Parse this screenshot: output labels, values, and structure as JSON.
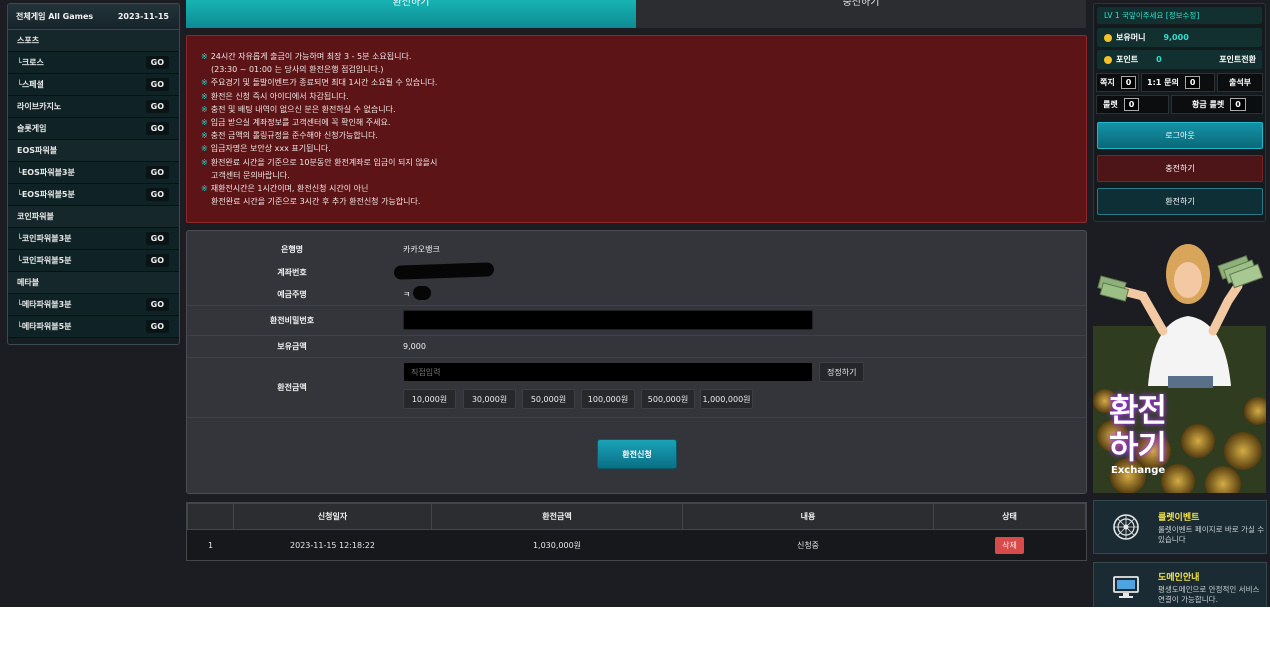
{
  "tabs": {
    "exchange": "환전하기",
    "charge": "충전하기"
  },
  "sidebar": {
    "header_title": "전체게임 All Games",
    "header_date": "2023-11-15",
    "go_label": "GO",
    "rows": [
      {
        "label": "스포츠",
        "type": "cat"
      },
      {
        "label": "└크로스",
        "type": "sub"
      },
      {
        "label": "└스페셜",
        "type": "sub"
      },
      {
        "label": "라이브카지노",
        "type": "sub"
      },
      {
        "label": "슬롯게임",
        "type": "sub"
      },
      {
        "label": "EOS파워볼",
        "type": "cat"
      },
      {
        "label": "└EOS파워볼3분",
        "type": "sub"
      },
      {
        "label": "└EOS파워볼5분",
        "type": "sub"
      },
      {
        "label": "코인파워볼",
        "type": "cat"
      },
      {
        "label": "└코인파워볼3분",
        "type": "sub"
      },
      {
        "label": "└코인파워볼5분",
        "type": "sub"
      },
      {
        "label": "메타볼",
        "type": "cat"
      },
      {
        "label": "└메타파워볼3분",
        "type": "sub"
      },
      {
        "label": "└메타파워볼5분",
        "type": "sub"
      }
    ]
  },
  "notice": {
    "lines": [
      {
        "star": true,
        "text": "24시간 자유롭게 출금이 가능하며 최장 3 - 5분 소요됩니다."
      },
      {
        "star": false,
        "text": "(23:30 ~ 01:00 는 당사의 환전은행 점검입니다.)"
      },
      {
        "star": true,
        "text": "주요경기 및 돌발이벤트가 종료되면 최대 1시간 소요될 수 있습니다."
      },
      {
        "star": true,
        "text": "환전은 신청 즉시 아이디에서 차감됩니다."
      },
      {
        "star": true,
        "text": "충전 및 배팅 내역이 없으신 분은 환전하실 수 없습니다."
      },
      {
        "star": true,
        "text": "입금 받으실 계좌정보를 고객센터에 꼭 확인해 주세요."
      },
      {
        "star": true,
        "text": "충전 금액의 롤링규정을 준수해야 신청가능합니다."
      },
      {
        "star": true,
        "text": "입금자명은 보안상 xxx 표기됩니다."
      },
      {
        "star": true,
        "text": "환전완료 시간을 기준으로 10분동안 환전계좌로 입금이 되지 않을시"
      },
      {
        "star": false,
        "text": "고객센터 문의바랍니다."
      },
      {
        "star": true,
        "text": "재환전시간은 1시간이며, 환전신청 시간이 아닌"
      },
      {
        "star": false,
        "text": "환전완료 시간을 기준으로 3시간 후 추가 환전신청 가능합니다."
      }
    ]
  },
  "form": {
    "bank_label": "은행명",
    "bank_value": "카카오뱅크",
    "account_label": "계좌번호",
    "holder_label": "예금주명",
    "holder_value": "ㅋ",
    "password_label": "환전비밀번호",
    "balance_label": "보유금액",
    "balance_value": "9,000",
    "amount_label": "환전금액",
    "amount_placeholder": "직접입력",
    "correct_label": "정정하기",
    "amounts": [
      "10,000원",
      "30,000원",
      "50,000원",
      "100,000원",
      "500,000원",
      "1,000,000원"
    ],
    "submit_label": "환전신청"
  },
  "history": {
    "headers": [
      "",
      "신청일자",
      "환전금액",
      "내용",
      "상태"
    ],
    "rows": [
      {
        "no": "1",
        "date": "2023-11-15 12:18:22",
        "amount": "1,030,000원",
        "content": "신청중",
        "status": "삭제"
      }
    ]
  },
  "user": {
    "level_text": "LV 1 국앞이주세요 [정보수정]",
    "money_label": "보유머니",
    "money_value": "9,000",
    "point_label": "포인트",
    "point_value": "0",
    "point_convert": "포인트전환",
    "note_label": "쪽지",
    "note_count": "0",
    "inquiry_label": "1:1 문의",
    "inquiry_count": "0",
    "attendance_label": "출석부",
    "roulette_label": "룰렛",
    "roulette_count": "0",
    "gold_roulette_label": "황금 룰렛",
    "gold_roulette_count": "0",
    "logout": "로그아웃",
    "charge": "충전하기",
    "exchange": "환전하기"
  },
  "banner": {
    "title": "환전하기",
    "subtitle": "Exchange"
  },
  "cards": [
    {
      "title": "룰렛이벤트",
      "desc": "룰렛이벤트 페이지로 바로 가실 수 있습니다",
      "icon": "roulette-icon"
    },
    {
      "title": "도메인안내",
      "desc": "평생도메인으로 안정적인 서비스연결이 가능합니다.",
      "icon": "monitor-icon"
    }
  ],
  "colors": {
    "accent": "#17b3b3",
    "notice_bg": "#5c1416",
    "delete": "#d74b4b"
  }
}
